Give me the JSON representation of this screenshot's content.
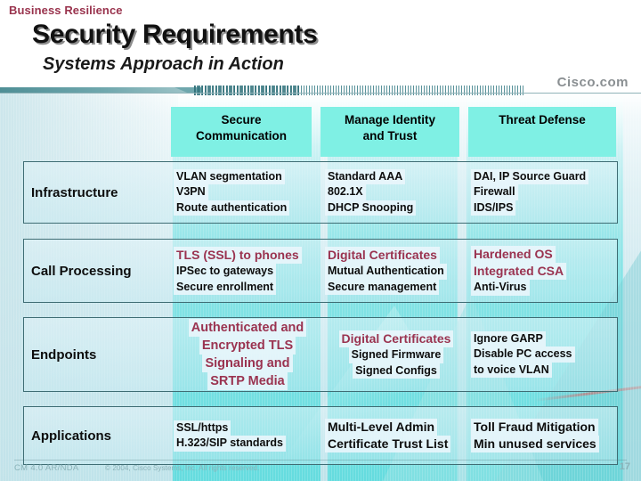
{
  "header": {
    "kicker": "Business Resilience",
    "title": "Security Requirements",
    "subtitle": "Systems Approach in Action",
    "brand": "Cisco.com"
  },
  "matrix": {
    "column_headers": [
      "Secure\nCommunication",
      "Manage Identity\nand Trust",
      "Threat Defense"
    ],
    "col1_line1": "Secure",
    "col1_line2": "Communication",
    "col2_line1": "Manage Identity",
    "col2_line2": "and Trust",
    "col3_line1": "Threat Defense",
    "rows": [
      {
        "label": "Infrastructure",
        "secure_communication": [
          "VLAN segmentation",
          "V3PN",
          "Route authentication"
        ],
        "manage_identity": [
          "Standard AAA",
          "802.1X",
          "DHCP Snooping"
        ],
        "threat_defense": [
          "DAI, IP Source Guard",
          "Firewall",
          "IDS/IPS"
        ]
      },
      {
        "label": "Call Processing",
        "secure_communication": [
          "TLS (SSL) to phones",
          "IPSec to gateways",
          "Secure enrollment"
        ],
        "manage_identity": [
          "Digital Certificates",
          "Mutual Authentication",
          "Secure management"
        ],
        "threat_defense": [
          "Hardened OS",
          "Integrated CSA",
          "Anti-Virus"
        ]
      },
      {
        "label": "Endpoints",
        "secure_communication": [
          "Authenticated and",
          "Encrypted TLS",
          "Signaling and",
          "SRTP Media"
        ],
        "manage_identity": [
          "Digital Certificates",
          "Signed Firmware",
          "Signed Configs"
        ],
        "threat_defense": [
          "Ignore GARP",
          "Disable PC access",
          "to voice VLAN"
        ]
      },
      {
        "label": "Applications",
        "secure_communication": [
          "SSL/https",
          "H.323/SIP standards"
        ],
        "manage_identity": [
          "Multi-Level Admin",
          "Certificate Trust List"
        ],
        "threat_defense": [
          "Toll Fraud Mitigation",
          "Min unused services"
        ]
      }
    ]
  },
  "footer": {
    "left": "CM 4.0 AR/NDA",
    "copyright": "© 2004, Cisco Systems, Inc. All rights reserved.",
    "page": "17"
  },
  "colors": {
    "accent_maroon": "#9a3350",
    "header_cyan": "#7ff0e4",
    "band_cyan": "#6cdfe0",
    "rule_teal": "#4f8f96"
  }
}
